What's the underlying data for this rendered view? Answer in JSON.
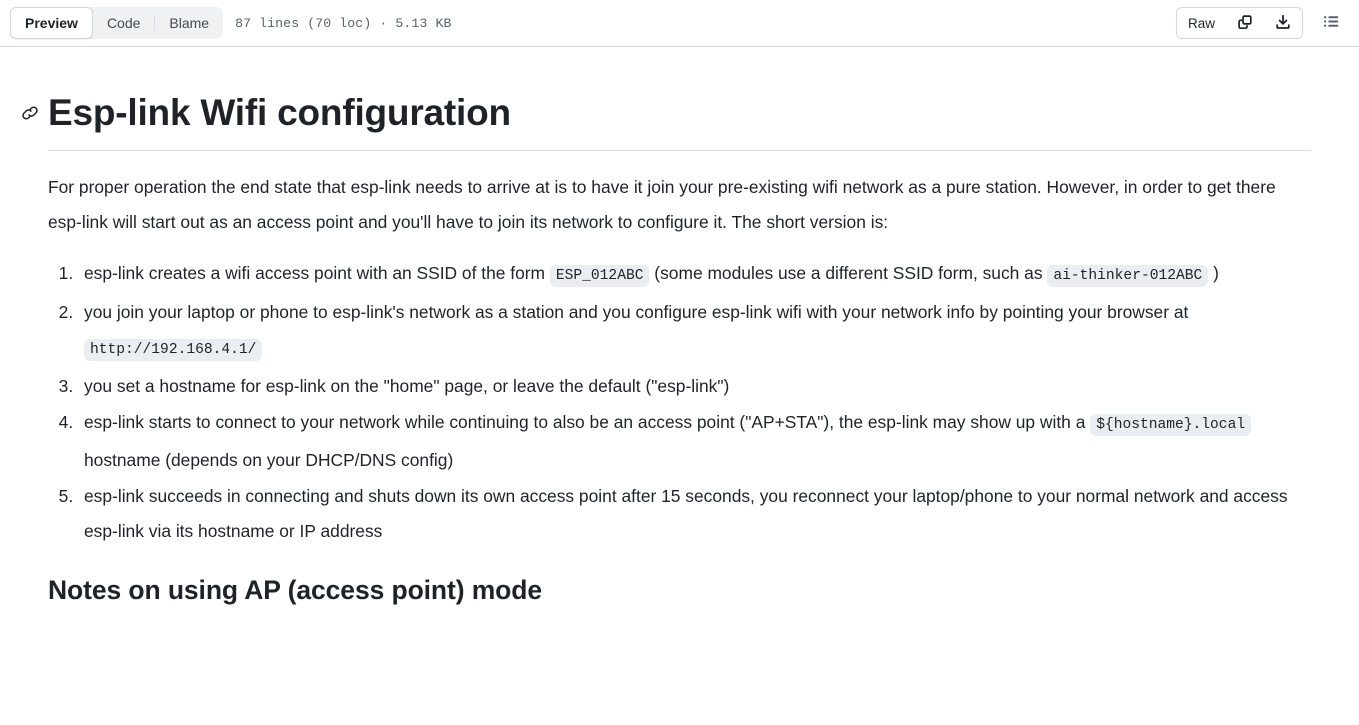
{
  "header": {
    "tabs": [
      {
        "label": "Preview",
        "active": true
      },
      {
        "label": "Code",
        "active": false
      },
      {
        "label": "Blame",
        "active": false
      }
    ],
    "file_meta": "87 lines (70 loc) · 5.13 KB",
    "raw_label": "Raw",
    "icons": {
      "copy": "copy-icon",
      "download": "download-icon",
      "outline": "outline-list-icon"
    }
  },
  "document": {
    "title": "Esp-link Wifi configuration",
    "intro": "For proper operation the end state that esp-link needs to arrive at is to have it join your pre-existing wifi network as a pure station. However, in order to get there esp-link will start out as an access point and you'll have to join its network to configure it. The short version is:",
    "steps": [
      {
        "before": "esp-link creates a wifi access point with an SSID of the form ",
        "code1": "ESP_012ABC",
        "middle": " (some modules use a different SSID form, such as ",
        "code2": "ai-thinker-012ABC",
        "after": " )"
      },
      {
        "before": "you join your laptop or phone to esp-link's network as a station and you configure esp-link wifi with your network info by pointing your browser at ",
        "code1": "http://192.168.4.1/",
        "middle": "",
        "code2": "",
        "after": ""
      },
      {
        "before": "you set a hostname for esp-link on the \"home\" page, or leave the default (\"esp-link\")",
        "code1": "",
        "middle": "",
        "code2": "",
        "after": ""
      },
      {
        "before": "esp-link starts to connect to your network while continuing to also be an access point (\"AP+STA\"), the esp-link may show up with a ",
        "code1": "${hostname}.local",
        "middle": " hostname (depends on your DHCP/DNS config)",
        "code2": "",
        "after": ""
      },
      {
        "before": "esp-link succeeds in connecting and shuts down its own access point after 15 seconds, you reconnect your laptop/phone to your normal network and access esp-link via its hostname or IP address",
        "code1": "",
        "middle": "",
        "code2": "",
        "after": ""
      }
    ],
    "section_heading": "Notes on using AP (access point) mode"
  },
  "colors": {
    "text": "#1f2328",
    "muted": "#59636e",
    "border": "#d1d9e0",
    "code_bg": "#eaeef2",
    "segment_bg": "#f0f1f3"
  }
}
